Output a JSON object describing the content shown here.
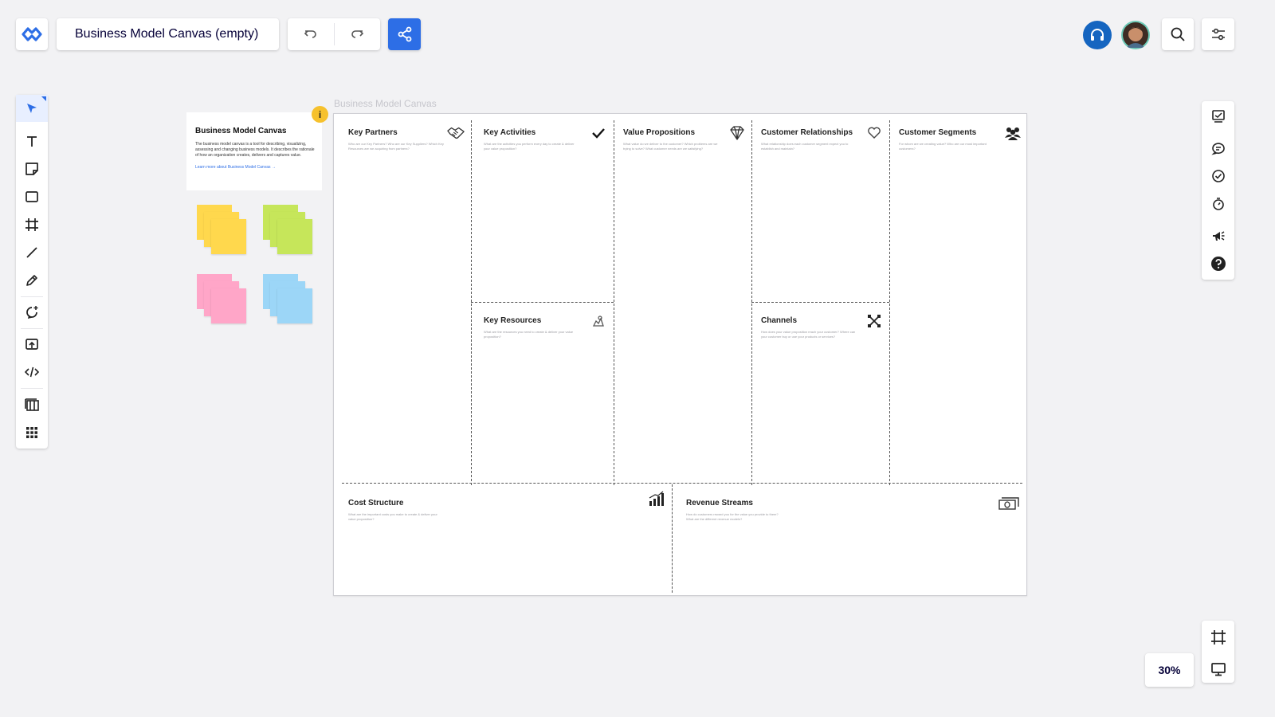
{
  "header": {
    "board_title": "Business Model Canvas (empty)"
  },
  "icons": {
    "logo": "miro-logo-icon",
    "undo": "undo-icon",
    "redo": "redo-icon",
    "share": "share-icon",
    "help": "headphones-icon",
    "search": "search-icon",
    "settings": "sliders-icon"
  },
  "colors": {
    "accent": "#2d6ee6",
    "help_button": "#1565c0",
    "sticky_yellow": "#ffd84d",
    "sticky_green": "#c6e65a",
    "sticky_pink": "#ffa6c8",
    "sticky_blue": "#9cd6f7"
  },
  "toolbar": {
    "tools": [
      "select",
      "text",
      "sticky-note",
      "shape",
      "frame",
      "line",
      "pen",
      "comment",
      "upload",
      "embed",
      "templates",
      "apps"
    ]
  },
  "right_toolbar": {
    "tools": [
      "presentation",
      "chat",
      "check",
      "timer",
      "announce",
      "help"
    ]
  },
  "zoom": {
    "level": "30%"
  },
  "info_card": {
    "title": "Business Model Canvas",
    "description": "The business model canvas is a tool for describing, visualizing, assessing and changing business models. It describes the rationale of how an organization creates, delivers and captures value.",
    "link": "Learn more about Business Model Canvas →",
    "badge": "i"
  },
  "canvas": {
    "frame_title": "Business Model Canvas",
    "sections": {
      "key_partners": {
        "title": "Key Partners",
        "questions": "Who are our Key Partners? Who are our Key Suppliers? Which Key Resources are we acquiring from partners?"
      },
      "key_activities": {
        "title": "Key Activities",
        "questions": "What are the activities you perform every day to create & deliver your value proposition?"
      },
      "key_resources": {
        "title": "Key Resources",
        "questions": "What are the resources you need to create & deliver your value proposition?"
      },
      "value_propositions": {
        "title": "Value Propositions",
        "questions": "What value do we deliver to the customer? Which problems are we trying to solve? What customer needs are we satisfying?"
      },
      "customer_relationships": {
        "title": "Customer Relationships",
        "questions": "What relationship does each customer segment expect you to establish and maintain?"
      },
      "channels": {
        "title": "Channels",
        "questions": "How does your value proposition reach your customer? Where can your customer buy or use your products or services?"
      },
      "customer_segments": {
        "title": "Customer Segments",
        "questions": "For whom are we creating value? Who are our most important customers?"
      },
      "cost_structure": {
        "title": "Cost Structure",
        "questions": "What are the important costs you make to create & deliver your value proposition?"
      },
      "revenue_streams": {
        "title": "Revenue Streams",
        "questions": "How do customers reward you for the value you provide to them? What are the different revenue models?"
      }
    }
  }
}
